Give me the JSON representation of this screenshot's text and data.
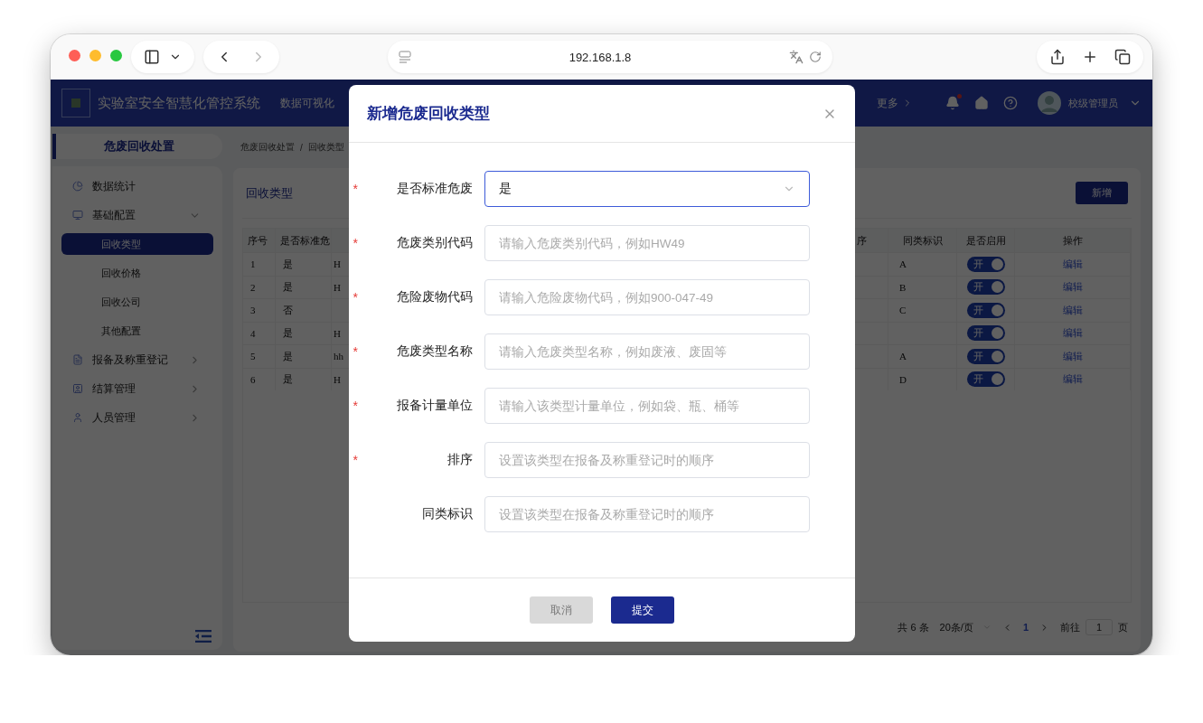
{
  "browser": {
    "address": "192.168.1.8"
  },
  "navbar": {
    "title": "实验室安全智慧化管控系统",
    "nav_items": [
      "数据可视化"
    ],
    "more": "更多",
    "unread": true,
    "user": "校级管理员"
  },
  "sidebar": {
    "header": "危废回收处置",
    "items": [
      {
        "label": "数据统计",
        "kind": "link"
      },
      {
        "label": "基础配置",
        "kind": "group",
        "expanded": true,
        "children": [
          {
            "label": "回收类型",
            "selected": true
          },
          {
            "label": "回收价格",
            "selected": false
          },
          {
            "label": "回收公司",
            "selected": false
          },
          {
            "label": "其他配置",
            "selected": false
          }
        ]
      },
      {
        "label": "报备及称重登记",
        "kind": "group",
        "expanded": false
      },
      {
        "label": "结算管理",
        "kind": "group",
        "expanded": false
      },
      {
        "label": "人员管理",
        "kind": "group",
        "expanded": false
      }
    ]
  },
  "breadcrumb": [
    "危废回收处置",
    "回收类型"
  ],
  "breadcrumb_separator": "/",
  "card": {
    "title": "回收类型",
    "add_button": "新增"
  },
  "table": {
    "columns_left": [
      "序号",
      "是否标准危"
    ],
    "columns_right": [
      "序",
      "同类标识",
      "是否启用",
      "操作"
    ],
    "rows": [
      {
        "index": "1",
        "standard": "是",
        "column_3": "H",
        "tag": "A",
        "enabled": true,
        "switch_label": "开",
        "action": "编辑"
      },
      {
        "index": "2",
        "standard": "是",
        "column_3": "H",
        "tag": "B",
        "enabled": true,
        "switch_label": "开",
        "action": "编辑"
      },
      {
        "index": "3",
        "standard": "否",
        "tag": "C",
        "enabled": true,
        "switch_label": "开",
        "action": "编辑"
      },
      {
        "index": "4",
        "standard": "是",
        "column_3": "H",
        "enabled": true,
        "switch_label": "开",
        "action": "编辑"
      },
      {
        "index": "5",
        "standard": "是",
        "column_3": "hh",
        "tag": "A",
        "enabled": true,
        "switch_label": "开",
        "action": "编辑"
      },
      {
        "index": "6",
        "standard": "是",
        "column_3": "H",
        "tag": "D",
        "enabled": true,
        "switch_label": "开",
        "action": "编辑"
      }
    ]
  },
  "pagination": {
    "total": "共 6 条",
    "page_size": "20条/页",
    "pages": [
      {
        "label": "1",
        "selected": true
      }
    ],
    "goto_label": "前往",
    "goto_value": "1",
    "page_suffix": "页"
  },
  "modal": {
    "title": "新增危废回收类型",
    "required_mark": "*",
    "fields": [
      {
        "label": "是否标准危废",
        "required": true,
        "kind": "select",
        "value": "是",
        "focused": true
      },
      {
        "label": "危废类别代码",
        "required": true,
        "kind": "input",
        "placeholder": "请输入危废类别代码，例如HW49",
        "focused": false
      },
      {
        "label": "危险废物代码",
        "required": true,
        "kind": "input",
        "placeholder": "请输入危险废物代码，例如900-047-49",
        "focused": false
      },
      {
        "label": "危废类型名称",
        "required": true,
        "kind": "input",
        "placeholder": "请输入危废类型名称，例如废液、废固等",
        "focused": false
      },
      {
        "label": "报备计量单位",
        "required": true,
        "kind": "input",
        "placeholder": "请输入该类型计量单位，例如袋、瓶、桶等",
        "focused": false
      },
      {
        "label": "排序",
        "required": true,
        "kind": "input",
        "placeholder": "设置该类型在报备及称重登记时的顺序",
        "focused": false
      },
      {
        "label": "同类标识",
        "required": false,
        "kind": "input",
        "placeholder": "设置该类型在报备及称重登记时的顺序",
        "focused": false
      }
    ],
    "buttons": [
      {
        "label": "取消",
        "kind": "cancel"
      },
      {
        "label": "提交",
        "kind": "primary"
      }
    ]
  }
}
